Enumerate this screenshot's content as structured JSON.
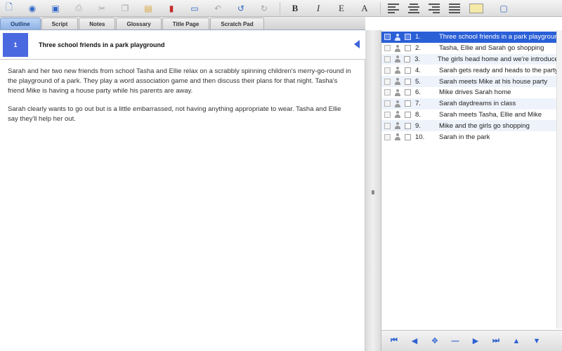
{
  "toolbar": {
    "buttons": [
      {
        "icon": "new-document-icon",
        "glyph": "🗋",
        "tone": "blue"
      },
      {
        "icon": "open-icon",
        "glyph": "◉",
        "tone": "blue"
      },
      {
        "icon": "save-icon",
        "glyph": "▣",
        "tone": "blue"
      },
      {
        "icon": "print-icon",
        "glyph": "⎙",
        "tone": "gray"
      },
      {
        "icon": "cut-icon",
        "glyph": "✂",
        "tone": "gray"
      },
      {
        "icon": "copy-icon",
        "glyph": "❐",
        "tone": "gray"
      },
      {
        "icon": "paste-icon",
        "glyph": "▤",
        "tone": "yellow"
      },
      {
        "icon": "book-icon",
        "glyph": "▮",
        "tone": "red"
      },
      {
        "icon": "monitor-icon",
        "glyph": "▭",
        "tone": "blue"
      },
      {
        "icon": "back-icon",
        "glyph": "↶",
        "tone": "gray"
      },
      {
        "icon": "undo-icon",
        "glyph": "↺",
        "tone": "blue"
      },
      {
        "icon": "redo-icon",
        "glyph": "↻",
        "tone": "gray"
      }
    ],
    "format": {
      "bold": "B",
      "italic": "I",
      "strike": "E",
      "underline": "A"
    }
  },
  "tabs": [
    "Outline",
    "Script",
    "Notes",
    "Glossary",
    "Title Page",
    "Scratch Pad"
  ],
  "scene": {
    "number": "1",
    "title": "Three school friends in a park playground",
    "paragraphs": [
      "Sarah and her two new friends from school Tasha and Ellie relax on a scrabbly spinning children's merry-go-round in the playground of a park. They play a word association game and then discuss their plans for that night. Tasha's friend Mike is having a house party while his parents are away.",
      "Sarah clearly wants to go out but is a little embarrassed, not having anything appropriate to wear. Tasha and Ellie say they'll help her out."
    ]
  },
  "scene_list": [
    {
      "num": "1.",
      "text": "Three school friends in a park playground",
      "selected": true
    },
    {
      "num": "2.",
      "text": "Tasha, Ellie and Sarah go shopping"
    },
    {
      "num": "3.",
      "text": "The girls head home and we're introduced"
    },
    {
      "num": "4.",
      "text": "Sarah gets ready and heads to the party"
    },
    {
      "num": "5.",
      "text": "Sarah meets Mike at his house party"
    },
    {
      "num": "6.",
      "text": "Mike drives Sarah home"
    },
    {
      "num": "7.",
      "text": "Sarah daydreams in class"
    },
    {
      "num": "8.",
      "text": "Sarah meets Tasha, Ellie and Mike"
    },
    {
      "num": "9.",
      "text": "Mike and the girls go shopping"
    },
    {
      "num": "10.",
      "text": "Sarah in the park"
    }
  ],
  "nav": [
    "first-icon",
    "previous-icon",
    "move-icon",
    "minus-icon",
    "next-icon",
    "last-icon",
    "up-icon",
    "down-icon"
  ],
  "colors": {
    "accent": "#2a5fd6",
    "scene_badge": "#4a69e0"
  }
}
